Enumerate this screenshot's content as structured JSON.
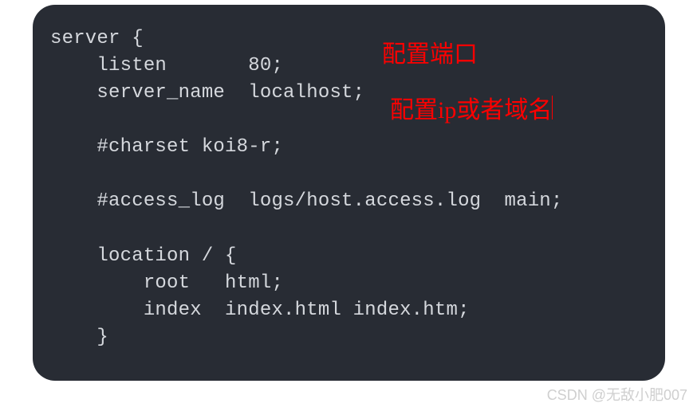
{
  "code": {
    "line1": "server {",
    "line2": "    listen       80;",
    "line3": "    server_name  localhost;",
    "line4": "",
    "line5": "    #charset koi8-r;",
    "line6": "",
    "line7": "    #access_log  logs/host.access.log  main;",
    "line8": "",
    "line9": "    location / {",
    "line10": "        root   html;",
    "line11": "        index  index.html index.htm;",
    "line12": "    }"
  },
  "annotations": {
    "port_label": "配置端口",
    "host_label": "配置ip或者域名"
  },
  "watermark": "CSDN @无敌小肥007"
}
